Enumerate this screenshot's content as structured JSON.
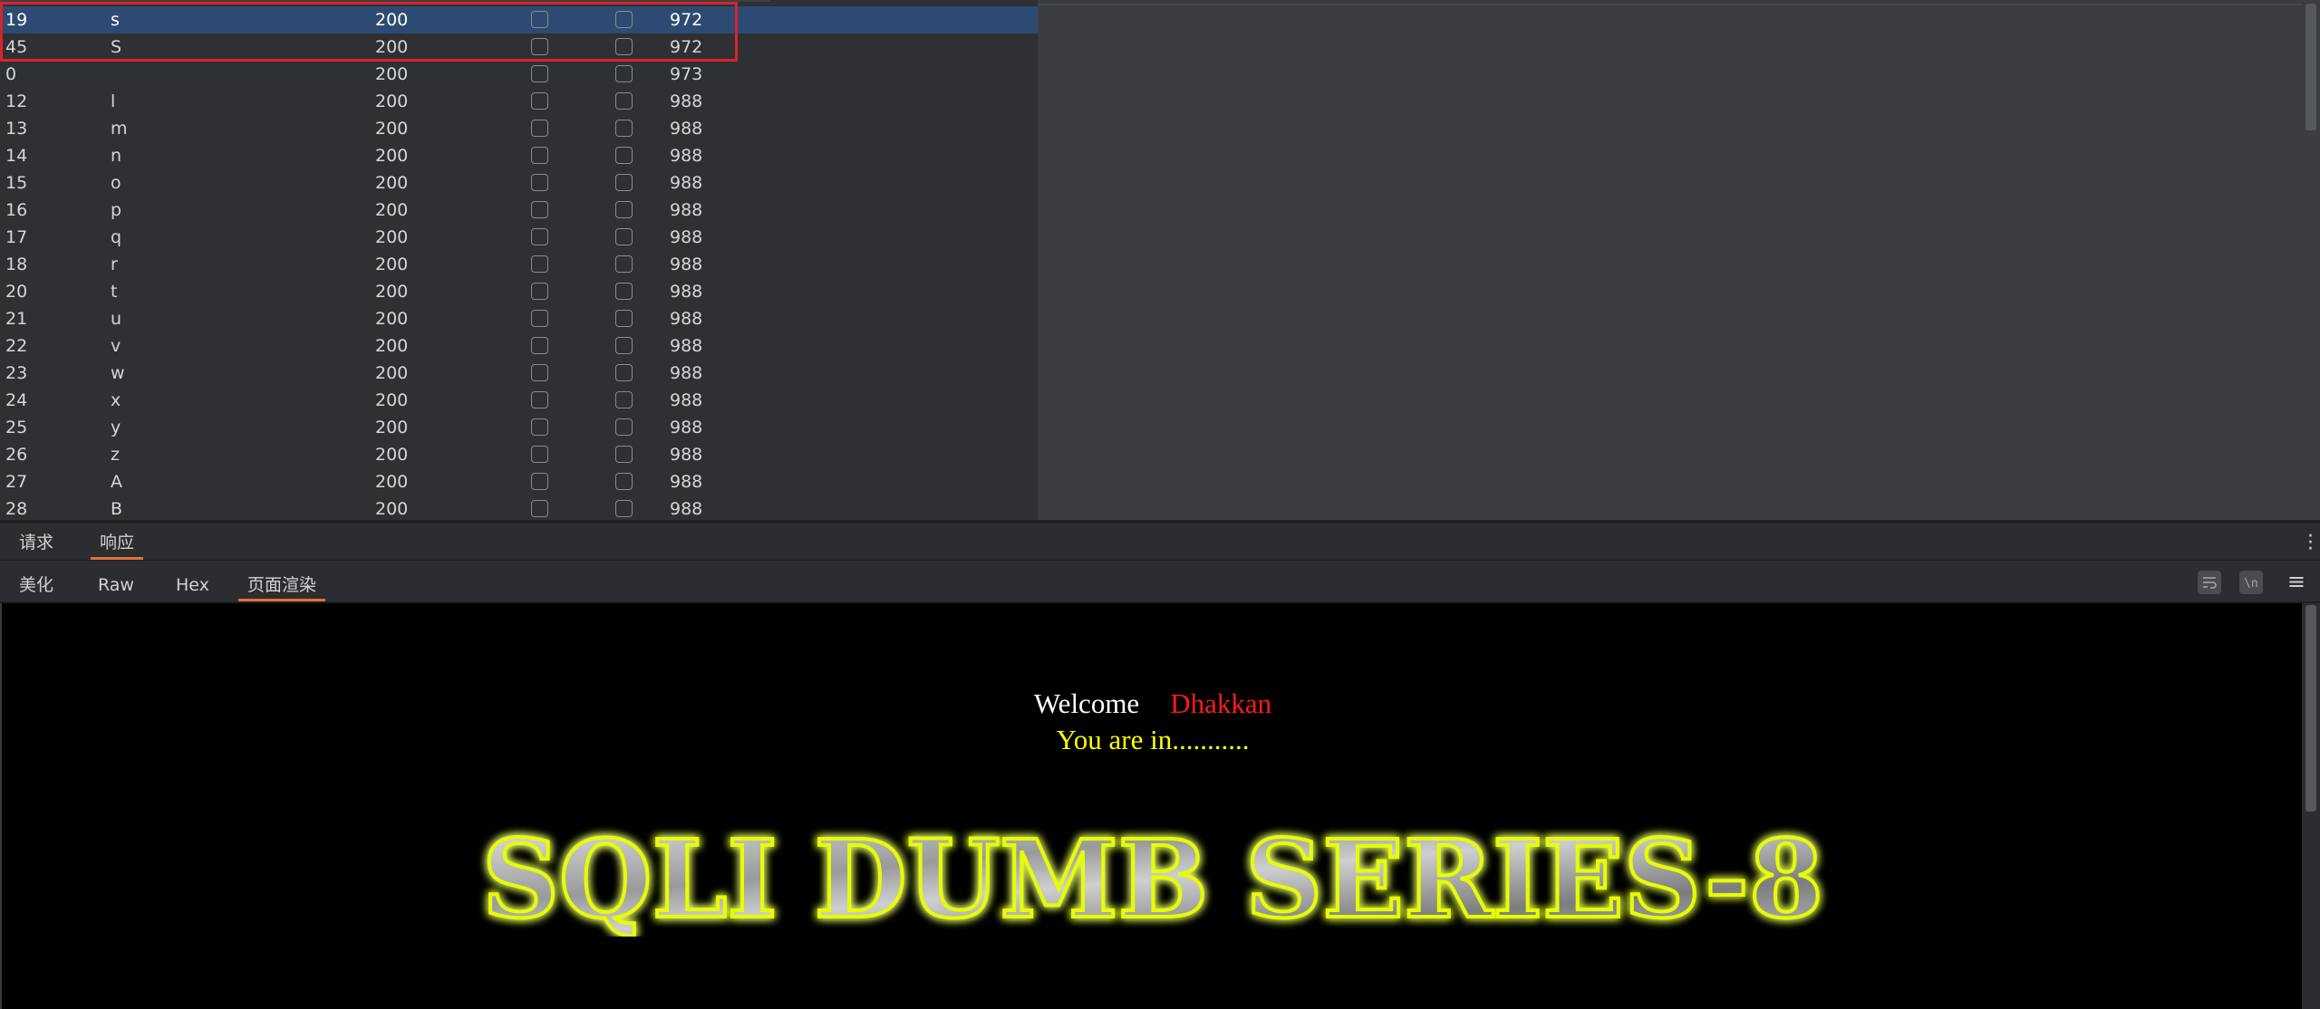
{
  "results": {
    "rows": [
      {
        "id": "19",
        "payload": "s",
        "status": "200",
        "length": "972",
        "selected": true
      },
      {
        "id": "45",
        "payload": "S",
        "status": "200",
        "length": "972"
      },
      {
        "id": "0",
        "payload": "",
        "status": "200",
        "length": "973"
      },
      {
        "id": "12",
        "payload": "l",
        "status": "200",
        "length": "988"
      },
      {
        "id": "13",
        "payload": "m",
        "status": "200",
        "length": "988"
      },
      {
        "id": "14",
        "payload": "n",
        "status": "200",
        "length": "988"
      },
      {
        "id": "15",
        "payload": "o",
        "status": "200",
        "length": "988"
      },
      {
        "id": "16",
        "payload": "p",
        "status": "200",
        "length": "988"
      },
      {
        "id": "17",
        "payload": "q",
        "status": "200",
        "length": "988"
      },
      {
        "id": "18",
        "payload": "r",
        "status": "200",
        "length": "988"
      },
      {
        "id": "20",
        "payload": "t",
        "status": "200",
        "length": "988"
      },
      {
        "id": "21",
        "payload": "u",
        "status": "200",
        "length": "988"
      },
      {
        "id": "22",
        "payload": "v",
        "status": "200",
        "length": "988"
      },
      {
        "id": "23",
        "payload": "w",
        "status": "200",
        "length": "988"
      },
      {
        "id": "24",
        "payload": "x",
        "status": "200",
        "length": "988"
      },
      {
        "id": "25",
        "payload": "y",
        "status": "200",
        "length": "988"
      },
      {
        "id": "26",
        "payload": "z",
        "status": "200",
        "length": "988"
      },
      {
        "id": "27",
        "payload": "A",
        "status": "200",
        "length": "988"
      },
      {
        "id": "28",
        "payload": "B",
        "status": "200",
        "length": "988"
      }
    ]
  },
  "req_resp_tabs": [
    {
      "label": "请求",
      "active": false
    },
    {
      "label": "响应",
      "active": true
    }
  ],
  "view_tabs": [
    {
      "label": "美化",
      "active": false
    },
    {
      "label": "Raw",
      "active": false
    },
    {
      "label": "Hex",
      "active": false
    },
    {
      "label": "页面渲染",
      "active": true
    }
  ],
  "toolbar_icons": [
    "wrap-icon",
    "newline-icon",
    "menu-icon"
  ],
  "rendered_page": {
    "welcome": "Welcome",
    "name": "Dhakkan",
    "message": "You are in...........",
    "banner": "SQLI DUMB SERIES-8"
  },
  "colors": {
    "selected_row": "#2d4b72",
    "highlight_box": "#d8232d",
    "active_tab_underline": "#e0723a",
    "banner_glow": "#e6ff00"
  }
}
